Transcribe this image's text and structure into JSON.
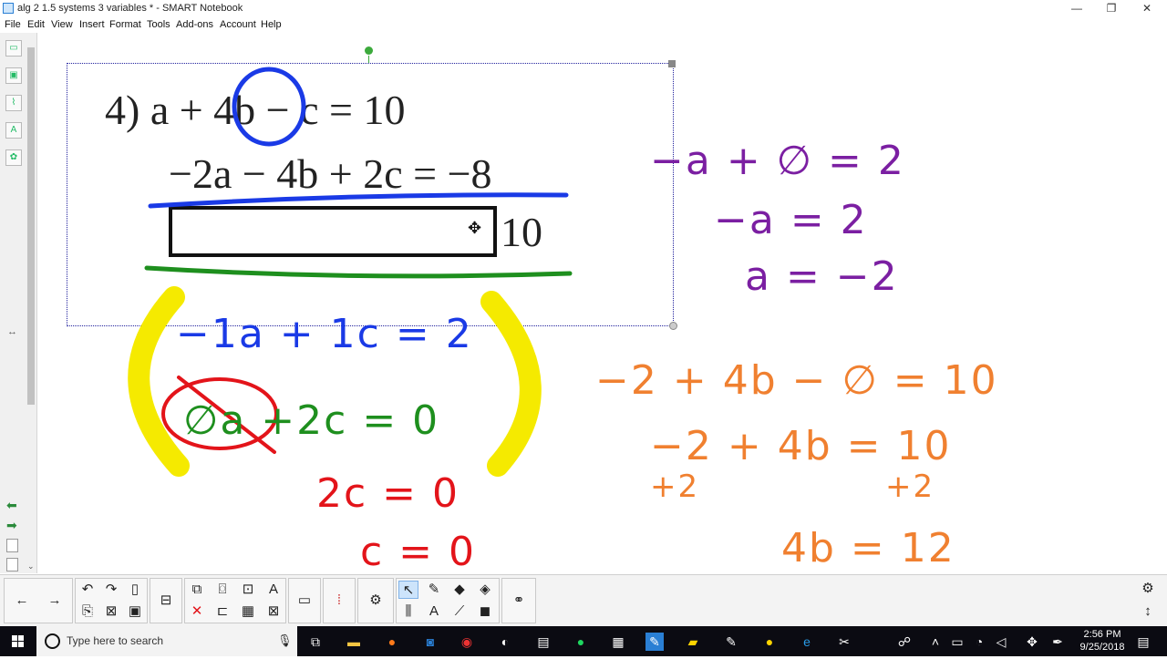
{
  "window": {
    "title": "alg 2 1.5 systems 3 variables * - SMART Notebook",
    "minimize": "—",
    "restore": "❐",
    "close": "✕"
  },
  "menu": [
    "File",
    "Edit",
    "View",
    "Insert",
    "Format",
    "Tools",
    "Add-ons",
    "Account",
    "Help"
  ],
  "sidebar_icons": [
    "page-sorter-icon",
    "gallery-icon",
    "attachments-icon",
    "properties-icon",
    "addons-icon"
  ],
  "side_arrows": {
    "left": "◀",
    "right": "▶"
  },
  "page": {
    "problem": {
      "line1": "4)  a + 4b − c = 10",
      "line2": "−2a − 4b + 2c = −8",
      "result_value": "10"
    },
    "ink_purple": [
      "−a + ∅ = 2",
      "−a = 2",
      "a = −2"
    ],
    "ink_blue": "−1a + 1c = 2",
    "ink_green": "∅a  +2c = 0",
    "ink_red": [
      "2c = 0",
      "c = 0"
    ],
    "ink_orange": [
      "−2 + 4b − ∅ = 10",
      "−2 + 4b = 10",
      "+2",
      "+2",
      "4b = 12"
    ]
  },
  "toolbar": {
    "groups": [
      [
        "previous-page-icon",
        "next-page-icon"
      ],
      [
        "undo-icon",
        "redo-icon",
        "new-page-icon",
        "paste-icon",
        "delete-page-icon",
        "save-icon"
      ],
      [
        "screen-shade-icon",
        "delete-icon"
      ],
      [
        "clone-icon",
        "screen-capture-icon",
        "table-icon",
        "text-icon",
        "clear-icon",
        "spreadsheet-icon"
      ],
      [
        "camera-icon"
      ],
      [
        "mark-icon"
      ],
      [
        "tools-icon"
      ],
      [
        "select-icon",
        "pens-icon",
        "eraser-icon",
        "fill-icon",
        "lines-icon",
        "shapes-icon",
        "text-tool-icon",
        "magic-pen-icon"
      ],
      [
        "measurement-icon"
      ]
    ],
    "settings": "⚙",
    "expand": "↕"
  },
  "taskbar": {
    "search_placeholder": "Type here to search",
    "time": "2:56 PM",
    "date": "9/25/2018",
    "apps": [
      "task-view-icon",
      "file-explorer-icon",
      "firefox-icon",
      "outlook-icon",
      "chrome-icon",
      "app-icon",
      "app2-icon",
      "spotify-icon",
      "app3-icon",
      "smart-notebook-icon",
      "sticky-notes-icon",
      "app4-icon",
      "app5-icon",
      "edge-icon",
      "app6-icon"
    ]
  }
}
